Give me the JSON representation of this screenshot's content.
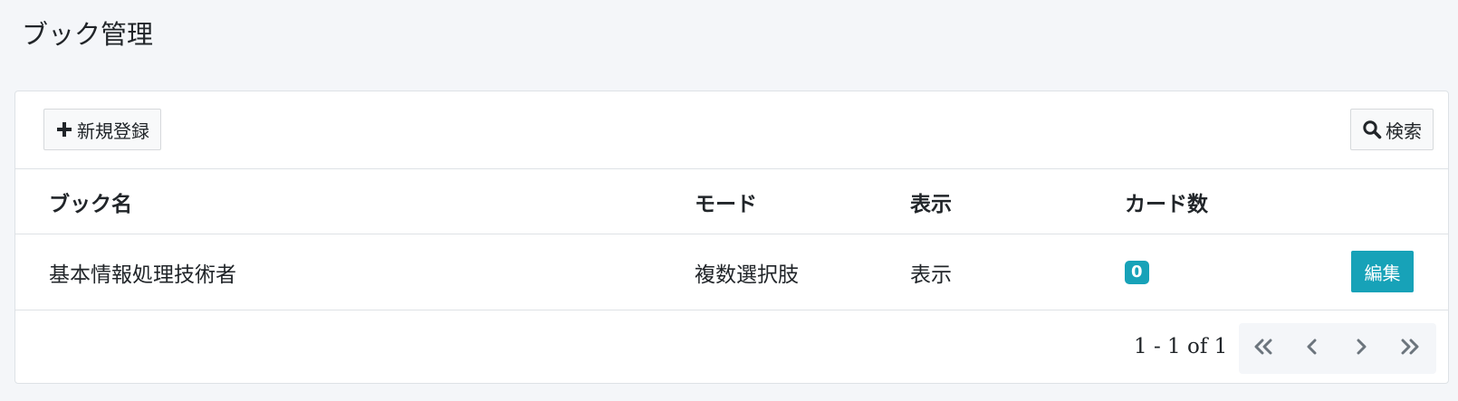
{
  "page": {
    "title": "ブック管理"
  },
  "toolbar": {
    "new_label": "新規登録",
    "new_icon": "plus-icon",
    "search_label": "検索",
    "search_icon": "search-icon"
  },
  "table": {
    "columns": [
      "ブック名",
      "モード",
      "表示",
      "カード数"
    ],
    "rows": [
      {
        "name": "基本情報処理技術者",
        "mode": "複数選択肢",
        "display": "表示",
        "card_count": "0",
        "edit_label": "編集"
      }
    ]
  },
  "pagination": {
    "info": "1 - 1 of 1",
    "buttons": [
      "first-page-icon",
      "prev-page-icon",
      "next-page-icon",
      "last-page-icon"
    ]
  },
  "colors": {
    "accent": "#17a2b8",
    "background": "#f4f6f9"
  }
}
